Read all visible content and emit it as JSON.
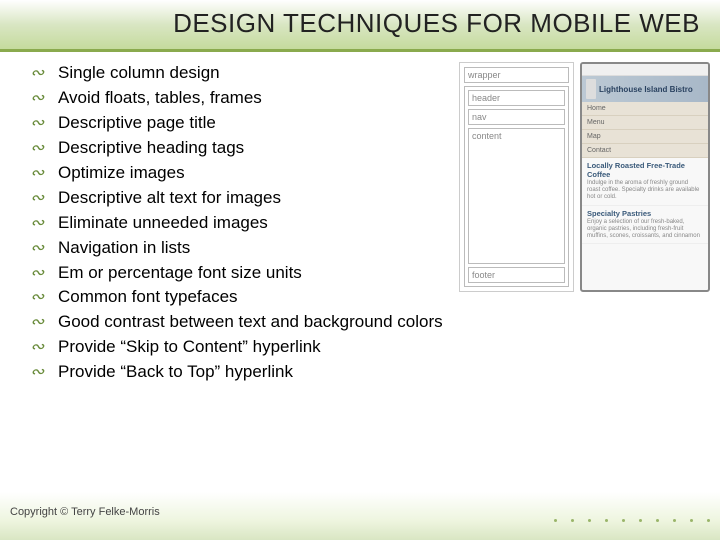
{
  "title": "DESIGN TECHNIQUES FOR MOBILE WEB",
  "bullets": [
    "Single column design",
    "Avoid floats, tables, frames",
    "Descriptive page title",
    "Descriptive heading tags",
    "Optimize images",
    "Descriptive alt text for images",
    "Eliminate unneeded images",
    "Navigation in lists",
    "Em or percentage font size units",
    "Common font typefaces",
    "Good contrast between text and background colors",
    "Provide “Skip to Content” hyperlink",
    "Provide “Back to Top” hyperlink"
  ],
  "wireframe": {
    "wrapper": "wrapper",
    "header": "header",
    "nav": "nav",
    "content": "content",
    "footer": "footer"
  },
  "mockup": {
    "brand": "Lighthouse Island Bistro",
    "nav": [
      "Home",
      "Menu",
      "Map",
      "Contact"
    ],
    "sections": [
      {
        "title": "Locally Roasted Free-Trade Coffee",
        "body": "Indulge in the aroma of freshly ground roast coffee. Specialty drinks are available hot or cold."
      },
      {
        "title": "Specialty Pastries",
        "body": "Enjoy a selection of our fresh-baked, organic pastries, including fresh-fruit muffins, scones, croissants, and cinnamon"
      }
    ]
  },
  "copyright": "Copyright © Terry Felke-Morris"
}
